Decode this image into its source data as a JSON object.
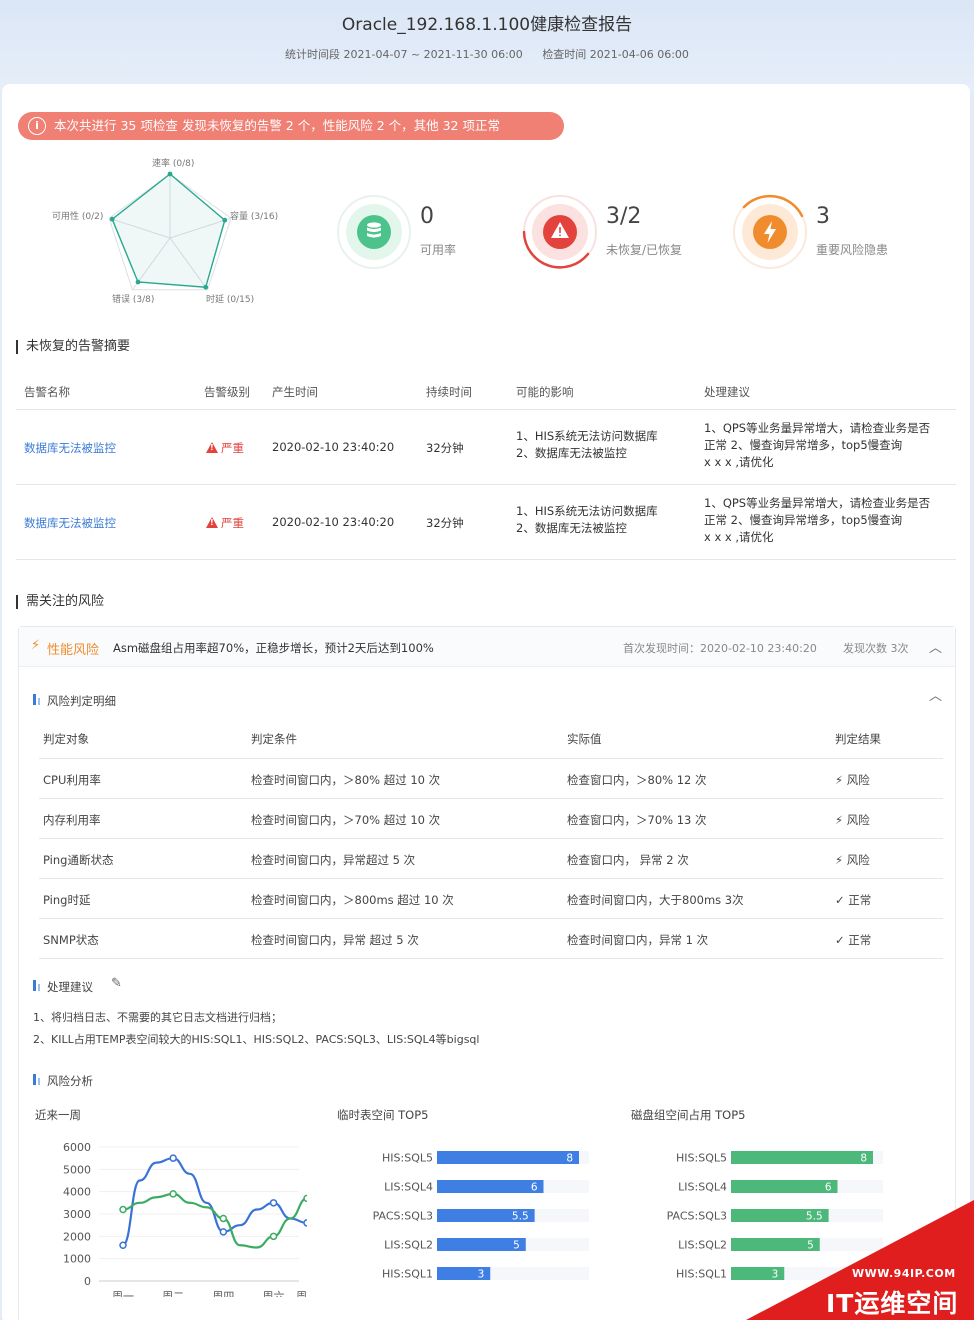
{
  "header": {
    "title": "Oracle_192.168.1.100健康检查报告",
    "period": "统计时间段 2021-04-07 ~ 2021-11-30 06:00",
    "check_time": "检查时间 2021-04-06 06:00"
  },
  "summary": {
    "icon": "info-icon",
    "text": "本次共进行 35 项检查  发现未恢复的告警 2 个，性能风险 2 个，其他 32 项正常"
  },
  "radar": {
    "labels": [
      "速率 (0/8)",
      "容量 (3/16)",
      "时延 (0/15)",
      "错误 (3/8)",
      "可用性 (0/2)"
    ],
    "values": [
      1.0,
      0.9,
      0.95,
      0.85,
      0.95
    ]
  },
  "kpis": [
    {
      "value": "0",
      "label": "可用率",
      "icon": "database-icon",
      "color": "#4cc38a",
      "bg": "#e3f6ec",
      "progress": 0.0
    },
    {
      "value": "3/2",
      "label": "未恢复/已恢复",
      "icon": "warning-icon",
      "color": "#e2433d",
      "bg": "#fbe1df",
      "progress": 0.6
    },
    {
      "value": "3",
      "label": "重要风险隐患",
      "icon": "lightning-icon",
      "color": "#f08c2e",
      "bg": "#fde9d6",
      "progress": 0.3
    }
  ],
  "alerts": {
    "section_title": "未恢复的告警摘要",
    "columns": [
      "告警名称",
      "告警级别",
      "产生时间",
      "持续时间",
      "可能的影响",
      "处理建议"
    ],
    "rows": [
      {
        "name": "数据库无法被监控",
        "level": "严重",
        "time": "2020-02-10 23:40:20",
        "duration": "32分钟",
        "impact": "1、HIS系统无法访问数据库\n2、数据库无法被监控",
        "advice": "1、QPS等业务量异常增大，请检查业务是否\n正常   2、慢查询异常增多，top5慢查询\nx x x ,请优化"
      },
      {
        "name": "数据库无法被监控",
        "level": "严重",
        "time": "2020-02-10 23:40:20",
        "duration": "32分钟",
        "impact": "1、HIS系统无法访问数据库\n2、数据库无法被监控",
        "advice": "1、QPS等业务量异常增大，请检查业务是否\n正常   2、慢查询异常增多，top5慢查询\nx x x ,请优化"
      }
    ]
  },
  "risks": {
    "section_title": "需关注的风险",
    "type": "性能风险",
    "description": "Asm磁盘组占用率超70%，正稳步增长，预计2天后达到100%",
    "first_found": "首次发现时间：2020-02-10 23:40:20",
    "count": "发现次数 3次",
    "detail_title": "风险判定明细",
    "columns": [
      "判定对象",
      "判定条件",
      "实际值",
      "判定结果"
    ],
    "rows": [
      {
        "target": "CPU利用率",
        "condition": "检查时间窗口内，＞80% 超过 10 次",
        "actual": "检查窗口内，＞80% 12 次",
        "result": "风险",
        "status": "risk"
      },
      {
        "target": "内存利用率",
        "condition": "检查时间窗口内，＞70% 超过 10 次",
        "actual": "检查窗口内，＞70% 13 次",
        "result": "风险",
        "status": "risk"
      },
      {
        "target": "Ping通断状态",
        "condition": "检查时间窗口内，异常超过 5 次",
        "actual": "检查窗口内， 异常 2 次",
        "result": "风险",
        "status": "risk"
      },
      {
        "target": "Ping时延",
        "condition": "检查时间窗口内，＞800ms 超过 10 次",
        "actual": "检查时间窗口内，大于800ms 3次",
        "result": "正常",
        "status": "ok"
      },
      {
        "target": "SNMP状态",
        "condition": "检查时间窗口内，异常 超过 5 次",
        "actual": "检查时间窗口内，异常 1 次",
        "result": "正常",
        "status": "ok"
      }
    ],
    "advice_title": "处理建议",
    "advice_lines": [
      "1、将归档日志、不需要的其它日志文档进行归档；",
      "2、KILL占用TEMP表空间较大的HIS:SQL1、HIS:SQL2、PACS:SQL3、LIS:SQL4等bigsql"
    ],
    "analysis_title": "风险分析"
  },
  "chart_data": [
    {
      "type": "line",
      "title": "近来一周",
      "x": [
        "周一",
        "周二",
        "周四",
        "周六",
        "周日"
      ],
      "x_points": [
        "周一",
        "",
        "",
        "周二",
        "",
        "",
        "周四",
        "",
        "",
        "周六",
        "",
        "周日"
      ],
      "ylim": [
        0,
        6000
      ],
      "yticks": [
        0,
        1000,
        2000,
        3000,
        4000,
        5000,
        6000
      ],
      "series": [
        {
          "color": "#3a72d8",
          "values": [
            1600,
            4500,
            5300,
            5500,
            4800,
            3500,
            2200,
            2500,
            3200,
            3500,
            2800,
            2600
          ]
        },
        {
          "color": "#3eab63",
          "values": [
            3200,
            3500,
            3750,
            3900,
            3500,
            3300,
            2800,
            1600,
            1500,
            2000,
            2800,
            3700
          ]
        }
      ]
    },
    {
      "type": "bar",
      "orientation": "horizontal",
      "title": "临时表空间 TOP5",
      "categories": [
        "HIS:SQL5",
        "LIS:SQL4",
        "PACS:SQL3",
        "LIS:SQL2",
        "HIS:SQL1"
      ],
      "values": [
        8,
        6,
        5.5,
        5,
        3
      ],
      "labels": [
        "8",
        "6",
        "5.5",
        "5",
        "3"
      ],
      "color": "#3f7fe3",
      "xlim": [
        0,
        8
      ]
    },
    {
      "type": "bar",
      "orientation": "horizontal",
      "title": "磁盘组空间占用  TOP5",
      "categories": [
        "HIS:SQL5",
        "LIS:SQL4",
        "PACS:SQL3",
        "LIS:SQL2",
        "HIS:SQL1"
      ],
      "values": [
        8,
        6,
        5.5,
        5,
        3
      ],
      "labels": [
        "8",
        "6",
        "5.5",
        "5",
        "3"
      ],
      "color": "#4cb87a",
      "xlim": [
        0,
        8
      ]
    }
  ],
  "watermark": {
    "url": "WWW.94IP.COM",
    "name": "IT运维空间"
  }
}
